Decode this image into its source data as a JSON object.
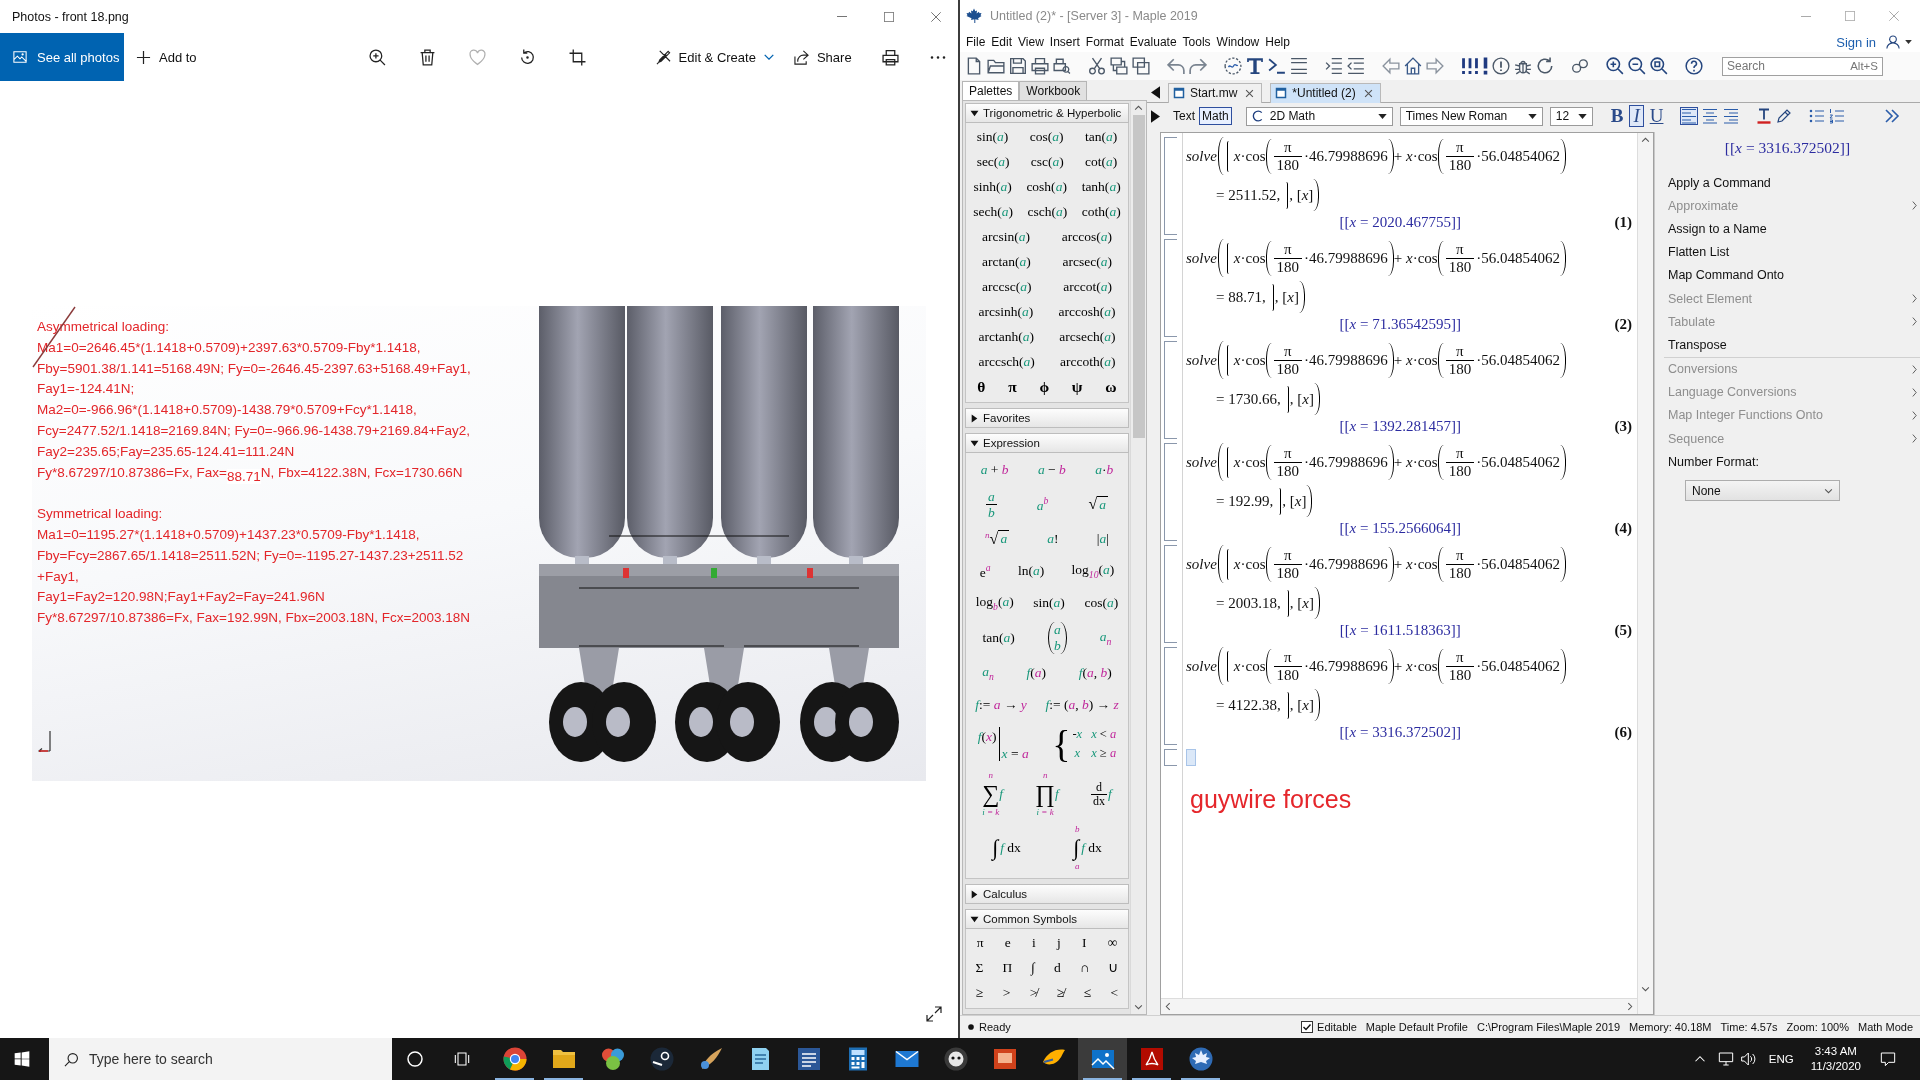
{
  "photos_window": {
    "title": "Photos - front 18.png",
    "toolbar": {
      "see_all": "See all photos",
      "add_to": "Add to",
      "edit_create": "Edit & Create",
      "share": "Share"
    },
    "image": {
      "sections": [
        {
          "heading": "Asymmetrical loading:",
          "lines": [
            "Ma1=0=2646.45*(1.1418+0.5709)+2397.63*0.5709-Fby*1.1418,",
            "Fby=5901.38/1.141=5168.49N; Fy=0=-2646.45-2397.63+5168.49+Fay1,",
            "Fay1=-124.41N;",
            "Ma2=0=-966.96*(1.1418+0.5709)-1438.79*0.5709+Fcy*1.1418,",
            "Fcy=2477.52/1.1418=2169.84N; Fy=0=-966.96-1438.79+2169.84+Fay2,",
            "Fay2=235.65;Fay=235.65-124.41=111.24N",
            "Fy*8.67297/10.87386=Fx, Fax=$_{88.71}$N, Fbx=4122.38N, Fcx=1730.66N"
          ]
        },
        {
          "heading": "Symmetrical loading:",
          "lines": [
            "Ma1=0=1195.27*(1.1418+0.5709)+1437.23*0.5709-Fby*1.1418,",
            "Fby=Fcy=2867.65/1.1418=2511.52N; Fy=0=-1195.27-1437.23+2511.52",
            "+Fay1,",
            "Fay1=Fay2=120.98N;Fay1+Fay2=Fay=241.96N",
            "Fy*8.67297/10.87386=Fx, Fax=192.99N, Fbx=2003.18N, Fcx=2003.18N"
          ]
        }
      ]
    }
  },
  "maple_window": {
    "title": "Untitled (2)* - [Server 3] - Maple 2019",
    "menu": [
      "File",
      "Edit",
      "View",
      "Insert",
      "Format",
      "Evaluate",
      "Tools",
      "Window",
      "Help"
    ],
    "sign_in": "Sign in",
    "search": {
      "placeholder": "Search",
      "shortcut": "Alt+S"
    },
    "side_tabs": [
      {
        "label": "Palettes",
        "selected": true
      },
      {
        "label": "Workbook",
        "selected": false
      }
    ],
    "doc_tabs": [
      {
        "label": "Start.mw",
        "selected": false
      },
      {
        "label": "*Untitled (2)",
        "selected": true
      }
    ],
    "format_bar": {
      "modes": [
        {
          "label": "Text",
          "selected": false
        },
        {
          "label": "Math",
          "selected": true
        }
      ],
      "style": "2D Math",
      "font": "Times New Roman",
      "size": "12",
      "emphasis": [
        {
          "kind": "bold",
          "label": "B",
          "selected": false
        },
        {
          "kind": "italic",
          "label": "I",
          "selected": true
        },
        {
          "kind": "underline",
          "label": "U",
          "selected": false
        }
      ],
      "alignment": [
        {
          "kind": "left",
          "selected": true
        },
        {
          "kind": "center",
          "selected": false
        },
        {
          "kind": "right",
          "selected": false
        }
      ]
    },
    "palettes": [
      {
        "title": "Trigonometric & Hyperbolic",
        "expanded": true,
        "rows": [
          [
            {
              "kind": "text",
              "text": "sin(*a*)"
            },
            {
              "kind": "text",
              "text": "cos(*a*)"
            },
            {
              "kind": "text",
              "text": "tan(*a*)"
            }
          ],
          [
            {
              "kind": "text",
              "text": "sec(*a*)"
            },
            {
              "kind": "text",
              "text": "csc(*a*)"
            },
            {
              "kind": "text",
              "text": "cot(*a*)"
            }
          ],
          [
            {
              "kind": "text",
              "text": "sinh(*a*)"
            },
            {
              "kind": "text",
              "text": "cosh(*a*)"
            },
            {
              "kind": "text",
              "text": "tanh(*a*)"
            }
          ],
          [
            {
              "kind": "text",
              "text": "sech(*a*)"
            },
            {
              "kind": "text",
              "text": "csch(*a*)"
            },
            {
              "kind": "text",
              "text": "coth(*a*)"
            }
          ],
          [
            {
              "kind": "text",
              "text": "arcsin(*a*)"
            },
            {
              "kind": "text",
              "text": "arccos(*a*)"
            }
          ],
          [
            {
              "kind": "text",
              "text": "arctan(*a*)"
            },
            {
              "kind": "text",
              "text": "arcsec(*a*)"
            }
          ],
          [
            {
              "kind": "text",
              "text": "arccsc(*a*)"
            },
            {
              "kind": "text",
              "text": "arccot(*a*)"
            }
          ],
          [
            {
              "kind": "text",
              "text": "arcsinh(*a*)"
            },
            {
              "kind": "text",
              "text": "arccosh(*a*)"
            }
          ],
          [
            {
              "kind": "text",
              "text": "arctanh(*a*)"
            },
            {
              "kind": "text",
              "text": "arcsech(*a*)"
            }
          ],
          [
            {
              "kind": "text",
              "text": "arccsch(*a*)"
            },
            {
              "kind": "text",
              "text": "arccoth(*a*)"
            }
          ]
        ],
        "symbols": [
          "θ",
          "π",
          "ϕ",
          "ψ",
          "ω"
        ]
      },
      {
        "title": "Favorites",
        "expanded": false
      },
      {
        "title": "Expression",
        "expanded": true,
        "rows": [
          [
            {
              "kind": "text",
              "text": "*a* + *b*"
            },
            {
              "kind": "text",
              "text": "*a* − *b*"
            },
            {
              "kind": "text",
              "text": "*a*·*b*"
            }
          ],
          [
            {
              "kind": "fraction",
              "num": "*a*",
              "den": "*b*"
            },
            {
              "kind": "text",
              "text": "*a*$^{b}$"
            },
            {
              "kind": "root",
              "sign": "√",
              "body": "*a*"
            }
          ],
          [
            {
              "kind": "root",
              "index": "n",
              "sign": "√",
              "body": "*a*"
            },
            {
              "kind": "text",
              "text": "*a*!"
            },
            {
              "kind": "text",
              "text": "|*a*|"
            }
          ],
          [
            {
              "kind": "text",
              "text": "e$^{a}$"
            },
            {
              "kind": "text",
              "text": "ln(*a*)"
            },
            {
              "kind": "text",
              "text": "log$_{10}$(*a*)"
            }
          ],
          [
            {
              "kind": "text",
              "text": "log$_{b}$(*a*)"
            },
            {
              "kind": "text",
              "text": "sin(*a*)"
            },
            {
              "kind": "text",
              "text": "cos(*a*)"
            }
          ],
          [
            {
              "kind": "text",
              "text": "tan(*a*)"
            },
            {
              "kind": "binomial",
              "top": "*a*",
              "bottom": "*b*"
            },
            {
              "kind": "text",
              "text": "*a*$_{n}$"
            }
          ],
          [
            {
              "kind": "text",
              "text": "*a*$_{n}$"
            },
            {
              "kind": "text",
              "text": "*f*(*a*)"
            },
            {
              "kind": "text",
              "text": "*f*(*a*, *b*)"
            }
          ],
          [
            {
              "kind": "text",
              "text": "*f*:= *a* → *y*"
            },
            {
              "kind": "text",
              "text": "*f*:= (*a*, *b*) → *z*"
            }
          ],
          [
            {
              "kind": "evaluation",
              "expr": "*f*(*x*)",
              "at": "*x* = *a*"
            },
            {
              "kind": "piecewise",
              "brace": "{",
              "cases": [
                {
                  "value": "-*x*",
                  "condition": "*x* < *a*"
                },
                {
                  "value": "*x*",
                  "condition": "*x* ≥ *a*"
                }
              ]
            }
          ],
          [
            {
              "kind": "big_operator",
              "sign": "∑",
              "upper": "n",
              "lower": "*i* = *k*",
              "body": "*f*"
            },
            {
              "kind": "big_operator",
              "sign": "∏",
              "upper": "n",
              "lower": "*i* = *k*",
              "body": "*f*"
            },
            {
              "kind": "derivative",
              "num": "d",
              "den": "dx",
              "body": "*f*"
            }
          ],
          [
            {
              "kind": "integral",
              "sign": "∫",
              "body": "*f* dx"
            },
            {
              "kind": "integral",
              "sign": "∫",
              "upper": "b",
              "lower": "a",
              "body": "*f* dx"
            }
          ]
        ]
      },
      {
        "title": "Calculus",
        "expanded": false
      },
      {
        "title": "Common Symbols",
        "expanded": true,
        "rows": [
          [
            {
              "kind": "text",
              "text": "π"
            },
            {
              "kind": "text",
              "text": "e"
            },
            {
              "kind": "text",
              "text": "i"
            },
            {
              "kind": "text",
              "text": "j"
            },
            {
              "kind": "text",
              "text": "I"
            },
            {
              "kind": "text",
              "text": "∞"
            }
          ],
          [
            {
              "kind": "text",
              "text": "Σ"
            },
            {
              "kind": "text",
              "text": "Π"
            },
            {
              "kind": "text",
              "text": "∫"
            },
            {
              "kind": "text",
              "text": "d"
            },
            {
              "kind": "text",
              "text": "∩"
            },
            {
              "kind": "text",
              "text": "∪"
            }
          ],
          [
            {
              "kind": "text",
              "text": "≥"
            },
            {
              "kind": "text",
              "text": ">"
            },
            {
              "kind": "text",
              "text": "≯"
            },
            {
              "kind": "text",
              "text": "≱"
            },
            {
              "kind": "text",
              "text": "≤"
            },
            {
              "kind": "text",
              "text": "<"
            }
          ]
        ]
      }
    ],
    "worksheet": {
      "groups": [
        {
          "command": "solve",
          "terms": [
            {
              "lead": "*x*·cos",
              "num": "π",
              "den": "180",
              "arg": "·46.79988696"
            },
            {
              "lead": "+ *x*·cos",
              "num": "π",
              "den": "180",
              "arg": "·56.04854062"
            }
          ],
          "rhs": "= 2511.52,",
          "vars": ", [*x*]",
          "result": "[[*x* = 2020.467755]]",
          "label": "(1)"
        },
        {
          "command": "solve",
          "terms": [
            {
              "lead": "*x*·cos",
              "num": "π",
              "den": "180",
              "arg": "·46.79988696"
            },
            {
              "lead": "+ *x*·cos",
              "num": "π",
              "den": "180",
              "arg": "·56.04854062"
            }
          ],
          "rhs": "= 88.71,",
          "vars": ", [*x*]",
          "result": "[[*x* = 71.36542595]]",
          "label": "(2)"
        },
        {
          "command": "solve",
          "terms": [
            {
              "lead": "*x*·cos",
              "num": "π",
              "den": "180",
              "arg": "·46.79988696"
            },
            {
              "lead": "+ *x*·cos",
              "num": "π",
              "den": "180",
              "arg": "·56.04854062"
            }
          ],
          "rhs": "= 1730.66,",
          "vars": ", [*x*]",
          "result": "[[*x* = 1392.281457]]",
          "label": "(3)"
        },
        {
          "command": "solve",
          "terms": [
            {
              "lead": "*x*·cos",
              "num": "π",
              "den": "180",
              "arg": "·46.79988696"
            },
            {
              "lead": "+ *x*·cos",
              "num": "π",
              "den": "180",
              "arg": "·56.04854062"
            }
          ],
          "rhs": "= 192.99,",
          "vars": ", [*x*]",
          "result": "[[*x* = 155.2566064]]",
          "label": "(4)"
        },
        {
          "command": "solve",
          "terms": [
            {
              "lead": "*x*·cos",
              "num": "π",
              "den": "180",
              "arg": "·46.79988696"
            },
            {
              "lead": "+ *x*·cos",
              "num": "π",
              "den": "180",
              "arg": "·56.04854062"
            }
          ],
          "rhs": "= 2003.18,",
          "vars": ", [*x*]",
          "result": "[[*x* = 1611.518363]]",
          "label": "(5)"
        },
        {
          "command": "solve",
          "terms": [
            {
              "lead": "*x*·cos",
              "num": "π",
              "den": "180",
              "arg": "·46.79988696"
            },
            {
              "lead": "+ *x*·cos",
              "num": "π",
              "den": "180",
              "arg": "·56.04854062"
            }
          ],
          "rhs": "= 4122.38,",
          "vars": ", [*x*]",
          "result": "[[*x* = 3316.372502]]",
          "label": "(6)"
        }
      ],
      "note": "guywire forces"
    },
    "context_panel": {
      "preview": "[[*x* = 3316.372502]]",
      "groups": [
        {
          "items": [
            {
              "label": "Apply a Command",
              "disabled": false,
              "submenu": false
            },
            {
              "label": "Approximate",
              "disabled": true,
              "submenu": true
            },
            {
              "label": "Assign to a Name",
              "disabled": false,
              "submenu": false
            },
            {
              "label": "Flatten List",
              "disabled": false,
              "submenu": false
            },
            {
              "label": "Map Command Onto",
              "disabled": false,
              "submenu": false
            },
            {
              "label": "Select Element",
              "disabled": true,
              "submenu": true
            },
            {
              "label": "Tabulate",
              "disabled": true,
              "submenu": true
            },
            {
              "label": "Transpose",
              "disabled": false,
              "submenu": false
            }
          ]
        },
        {
          "items": [
            {
              "label": "Conversions",
              "disabled": true,
              "submenu": true
            },
            {
              "label": "Language Conversions",
              "disabled": true,
              "submenu": true
            },
            {
              "label": "Map Integer Functions Onto",
              "disabled": true,
              "submenu": true
            },
            {
              "label": "Sequence",
              "disabled": true,
              "submenu": true
            }
          ]
        }
      ],
      "number_format": {
        "label": "Number Format:",
        "value": "None"
      }
    },
    "status_bar": {
      "state": "Ready",
      "editable": {
        "label": "Editable",
        "checked": true
      },
      "fields": [
        "Maple Default Profile",
        "C:\\Program Files\\Maple 2019",
        "Memory: 40.18M",
        "Time: 4.57s",
        "Zoom: 100%",
        "Math Mode"
      ]
    }
  },
  "taskbar": {
    "search_placeholder": "Type here to search",
    "apps": [
      {
        "kind": "browser",
        "running": true,
        "active": false
      },
      {
        "kind": "folder",
        "running": true,
        "active": false
      },
      {
        "kind": "colorful",
        "running": false,
        "active": false
      },
      {
        "kind": "disc",
        "running": false,
        "active": false
      },
      {
        "kind": "brush",
        "running": false,
        "active": false
      },
      {
        "kind": "notepad",
        "running": false,
        "active": false
      },
      {
        "kind": "document",
        "running": false,
        "active": false
      },
      {
        "kind": "calculator",
        "running": false,
        "active": false
      },
      {
        "kind": "mail",
        "running": false,
        "active": false
      },
      {
        "kind": "dark",
        "running": false,
        "active": false
      },
      {
        "kind": "slides",
        "running": false,
        "active": false
      },
      {
        "kind": "bird",
        "running": false,
        "active": false
      },
      {
        "kind": "photos",
        "running": true,
        "active": true
      },
      {
        "kind": "pdf",
        "running": true,
        "active": false
      },
      {
        "kind": "globe",
        "running": true,
        "active": false
      }
    ],
    "language": "ENG",
    "time": "3:43 AM",
    "date": "11/3/2020"
  }
}
